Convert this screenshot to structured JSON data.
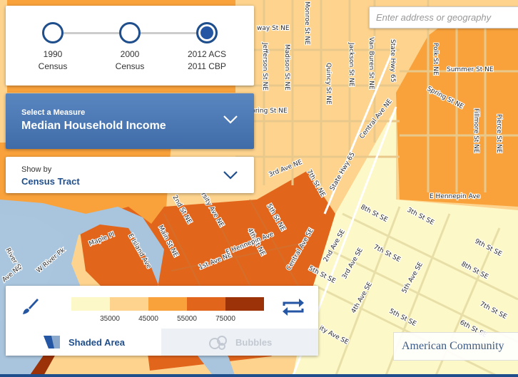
{
  "search": {
    "placeholder": "Enter address or geography"
  },
  "timeline": {
    "stops": [
      {
        "line1": "1990",
        "line2": "Census",
        "active": false
      },
      {
        "line1": "2000",
        "line2": "Census",
        "active": false
      },
      {
        "line1": "2012 ACS",
        "line2": "2011 CBP",
        "active": true
      }
    ]
  },
  "measure": {
    "caption": "Select a Measure",
    "value": "Median Household Income"
  },
  "show_by": {
    "caption": "Show by",
    "value": "Census Tract"
  },
  "legend": {
    "colors": [
      "#fdf8c8",
      "#fdd38e",
      "#f9a23b",
      "#e2651c",
      "#9c3208"
    ],
    "breaks": [
      "35000",
      "45000",
      "55000",
      "75000"
    ],
    "tabs": {
      "shaded": "Shaded Area",
      "bubbles": "Bubbles"
    },
    "active_tab": "shaded"
  },
  "brand": "American Community",
  "map": {
    "streets": [
      "way St NE",
      "Monroe St NE",
      "Jefferson St NE",
      "Madison St NE",
      "Quincy St NE",
      "Jackson St NE",
      "Van Buren St NE",
      "State Hwy 65",
      "Polk St NE",
      "Summer St NE",
      "Spring St NE",
      "Fillmore St NE",
      "Pierce St NE",
      "Central Ave NE",
      "pring St NE",
      "3rd Ave NE",
      "7th St NE",
      "State Hwy 65",
      "E Hennepin Ave",
      "8th St SE",
      "3th St SE",
      "9th St SE",
      "2nd St NE",
      "rsity Ave NE",
      "5th St NE",
      "Maple Pl",
      "E Island Ave",
      "Main St NE",
      "4th St NE",
      "1st Ave NE",
      "E Hennepin Ave",
      "Central Ave SE",
      "2nd Ave SE",
      "3rd Ave SE",
      "7th St SE",
      "8th St SE",
      "5th St SE",
      "4th Ave SE",
      "5th Ave SE",
      "5th St SE",
      "6th St SE",
      "7th St SE",
      "ity Ave SE",
      "River St",
      "W River Pk",
      "Ave N",
      "7th",
      "St NE",
      "ral Ave SE",
      "Ma",
      "Ave S",
      "So"
    ]
  }
}
